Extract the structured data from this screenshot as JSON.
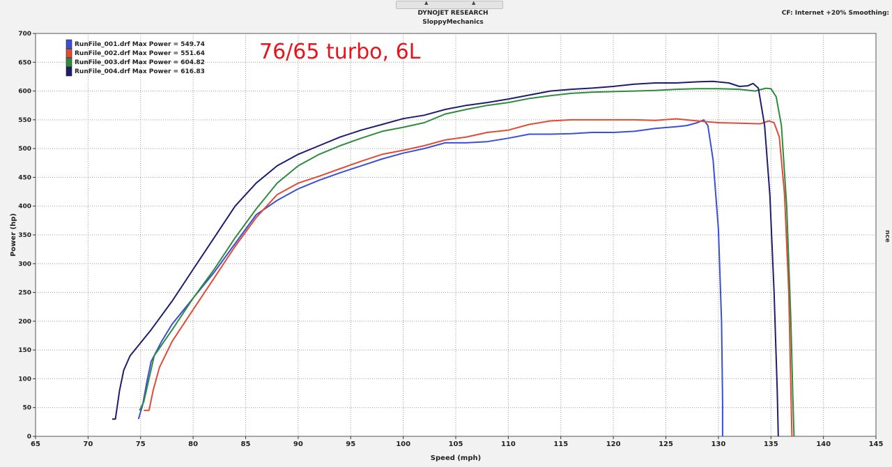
{
  "window": {
    "title": "DYNOJET RESEARCH",
    "subtitle": "SloppyMechanics",
    "correction": "CF: Internet +20%  Smoothing:",
    "edge_label": "nce"
  },
  "colors": {
    "plot_bg": "#ffffff",
    "grid": "#9a9a9a",
    "annotation": "#e8141b"
  },
  "chart_data": {
    "type": "line",
    "title": "",
    "annotation": "76/65 turbo, 6L",
    "xlabel": "Speed (mph)",
    "ylabel": "Power (hp)",
    "xlim": [
      65,
      145
    ],
    "ylim": [
      0,
      700
    ],
    "x_ticks": [
      65,
      70,
      75,
      80,
      85,
      90,
      95,
      100,
      105,
      110,
      115,
      120,
      125,
      130,
      135,
      140,
      145
    ],
    "y_ticks": [
      0,
      50,
      100,
      150,
      200,
      250,
      300,
      350,
      400,
      450,
      500,
      550,
      600,
      650,
      700
    ],
    "grid": true,
    "legend_position": "top-left",
    "series": [
      {
        "name": "RunFile_001.drf Max Power = 549.74",
        "color": "#3a4fd8",
        "points": [
          [
            74.8,
            30
          ],
          [
            75.2,
            55
          ],
          [
            75.6,
            95
          ],
          [
            76,
            130
          ],
          [
            77,
            165
          ],
          [
            78,
            195
          ],
          [
            80,
            240
          ],
          [
            82,
            285
          ],
          [
            84,
            335
          ],
          [
            86,
            385
          ],
          [
            88,
            410
          ],
          [
            90,
            430
          ],
          [
            92,
            445
          ],
          [
            94,
            458
          ],
          [
            96,
            470
          ],
          [
            98,
            482
          ],
          [
            100,
            492
          ],
          [
            102,
            500
          ],
          [
            104,
            510
          ],
          [
            106,
            510
          ],
          [
            108,
            512
          ],
          [
            110,
            518
          ],
          [
            112,
            525
          ],
          [
            114,
            525
          ],
          [
            116,
            526
          ],
          [
            118,
            528
          ],
          [
            120,
            528
          ],
          [
            122,
            530
          ],
          [
            124,
            535
          ],
          [
            126,
            538
          ],
          [
            127,
            540
          ],
          [
            128,
            545
          ],
          [
            128.6,
            549.7
          ],
          [
            129,
            540
          ],
          [
            129.5,
            480
          ],
          [
            130,
            360
          ],
          [
            130.3,
            200
          ],
          [
            130.4,
            60
          ],
          [
            130.4,
            0
          ]
        ]
      },
      {
        "name": "RunFile_002.drf Max Power = 551.64",
        "color": "#e24a33",
        "points": [
          [
            75.3,
            45
          ],
          [
            75.8,
            45
          ],
          [
            76.2,
            80
          ],
          [
            76.8,
            120
          ],
          [
            78,
            165
          ],
          [
            80,
            220
          ],
          [
            82,
            275
          ],
          [
            84,
            330
          ],
          [
            86,
            380
          ],
          [
            88,
            420
          ],
          [
            90,
            440
          ],
          [
            92,
            452
          ],
          [
            94,
            465
          ],
          [
            96,
            478
          ],
          [
            98,
            490
          ],
          [
            100,
            497
          ],
          [
            102,
            505
          ],
          [
            104,
            515
          ],
          [
            106,
            520
          ],
          [
            108,
            528
          ],
          [
            110,
            532
          ],
          [
            112,
            542
          ],
          [
            114,
            548
          ],
          [
            116,
            550
          ],
          [
            118,
            550
          ],
          [
            120,
            550
          ],
          [
            122,
            550
          ],
          [
            124,
            549
          ],
          [
            126,
            551.6
          ],
          [
            128,
            548
          ],
          [
            130,
            545
          ],
          [
            132,
            544
          ],
          [
            134,
            543
          ],
          [
            134.8,
            548
          ],
          [
            135.3,
            545
          ],
          [
            135.8,
            520
          ],
          [
            136.3,
            420
          ],
          [
            136.7,
            250
          ],
          [
            136.9,
            80
          ],
          [
            137,
            0
          ]
        ]
      },
      {
        "name": "RunFile_003.drf Max Power = 604.82",
        "color": "#2e8b3e",
        "points": [
          [
            74.9,
            45
          ],
          [
            75.3,
            60
          ],
          [
            75.8,
            100
          ],
          [
            76.3,
            140
          ],
          [
            78,
            185
          ],
          [
            80,
            240
          ],
          [
            82,
            290
          ],
          [
            84,
            345
          ],
          [
            86,
            395
          ],
          [
            88,
            440
          ],
          [
            90,
            470
          ],
          [
            92,
            490
          ],
          [
            94,
            505
          ],
          [
            96,
            518
          ],
          [
            98,
            530
          ],
          [
            100,
            537
          ],
          [
            102,
            545
          ],
          [
            104,
            560
          ],
          [
            106,
            568
          ],
          [
            108,
            575
          ],
          [
            110,
            580
          ],
          [
            112,
            587
          ],
          [
            114,
            592
          ],
          [
            116,
            596
          ],
          [
            118,
            598
          ],
          [
            120,
            599
          ],
          [
            122,
            600
          ],
          [
            124,
            601
          ],
          [
            126,
            603
          ],
          [
            128,
            604
          ],
          [
            130,
            604
          ],
          [
            132,
            603
          ],
          [
            133.5,
            600
          ],
          [
            134.5,
            604.8
          ],
          [
            135,
            604
          ],
          [
            135.5,
            590
          ],
          [
            136,
            540
          ],
          [
            136.5,
            400
          ],
          [
            136.9,
            200
          ],
          [
            137.1,
            60
          ],
          [
            137.2,
            0
          ]
        ]
      },
      {
        "name": "RunFile_004.drf Max Power = 616.83",
        "color": "#1d1d6e",
        "points": [
          [
            72.3,
            30
          ],
          [
            72.6,
            30
          ],
          [
            73,
            80
          ],
          [
            73.4,
            115
          ],
          [
            74,
            140
          ],
          [
            76,
            185
          ],
          [
            78,
            235
          ],
          [
            80,
            290
          ],
          [
            82,
            345
          ],
          [
            84,
            400
          ],
          [
            86,
            440
          ],
          [
            88,
            470
          ],
          [
            90,
            490
          ],
          [
            92,
            505
          ],
          [
            94,
            520
          ],
          [
            96,
            532
          ],
          [
            98,
            542
          ],
          [
            100,
            552
          ],
          [
            102,
            558
          ],
          [
            104,
            568
          ],
          [
            106,
            575
          ],
          [
            108,
            580
          ],
          [
            110,
            586
          ],
          [
            112,
            593
          ],
          [
            114,
            600
          ],
          [
            116,
            603
          ],
          [
            118,
            605
          ],
          [
            120,
            608
          ],
          [
            122,
            612
          ],
          [
            124,
            614
          ],
          [
            126,
            614
          ],
          [
            128,
            616
          ],
          [
            129.5,
            616.8
          ],
          [
            131,
            614
          ],
          [
            132,
            608
          ],
          [
            132.8,
            609
          ],
          [
            133.3,
            613
          ],
          [
            133.8,
            605
          ],
          [
            134.4,
            540
          ],
          [
            134.9,
            420
          ],
          [
            135.3,
            250
          ],
          [
            135.6,
            80
          ],
          [
            135.7,
            0
          ]
        ]
      }
    ]
  }
}
